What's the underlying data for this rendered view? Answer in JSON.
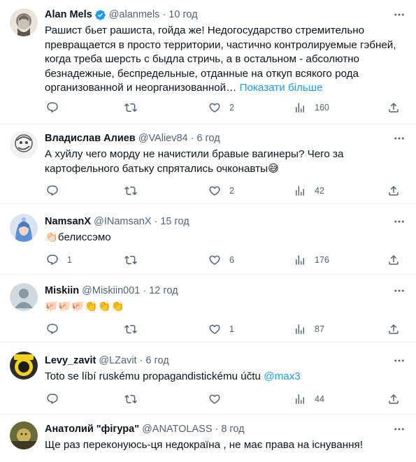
{
  "tweets": [
    {
      "name": "Alan Mels",
      "verified": true,
      "handle": "@alanmels",
      "time": "10 год",
      "text": "Рашист бьет рашиста, гойда же! Недогосударство стремительно превращается в просто территории, частично контролируемые гэбней, когда треба шерсть с быдла стричь, а в остальном - абсолютно безнадежные, беспредельные, отданные на откуп всякого рода организованной и неорганизованной…",
      "show_more": "Показати більше",
      "replies": "",
      "retweets": "",
      "likes": "2",
      "views": "160"
    },
    {
      "name": "Владислав Алиев",
      "verified": false,
      "handle": "@VAliev84",
      "time": "6 год",
      "text": "А хуйлу чего морду не начистили бравые вагинеры? Чего за картофельного батьку спрятались очконавты😅",
      "replies": "",
      "retweets": "",
      "likes": "2",
      "views": "42"
    },
    {
      "name": "NamsanX",
      "verified": false,
      "handle": "@INamsanX",
      "time": "15 год",
      "text": "👏🏻белиссэмо",
      "replies": "1",
      "retweets": "",
      "likes": "6",
      "views": "176"
    },
    {
      "name": "Miskiin",
      "verified": false,
      "handle": "@Miskiin001",
      "time": "12 год",
      "text": "🐖🐖🐖👏👏👏",
      "replies": "",
      "retweets": "",
      "likes": "1",
      "views": "87"
    },
    {
      "name": "Levy_zavit",
      "verified": false,
      "handle": "@LZavit",
      "time": "6 год",
      "text": "Toto se líbí ruskému propagandistickému účtu ",
      "mention": "@max3",
      "replies": "",
      "retweets": "",
      "likes": "",
      "views": "44"
    },
    {
      "name": "Анатолий \"фігура\"",
      "verified": false,
      "handle": "@ANATOLASS",
      "time": "8 год",
      "text": "Ще раз переконуюсь-ця недокраїна , не має права на існування!"
    }
  ],
  "separator": "·",
  "icons": {
    "verified": "verified-badge-icon",
    "more": "more-options-icon",
    "reply": "reply-icon",
    "retweet": "retweet-icon",
    "like": "like-icon",
    "views": "views-icon",
    "share": "share-icon"
  },
  "colors": {
    "link": "#1d9bf0",
    "muted": "#536471",
    "text": "#0f1419"
  }
}
